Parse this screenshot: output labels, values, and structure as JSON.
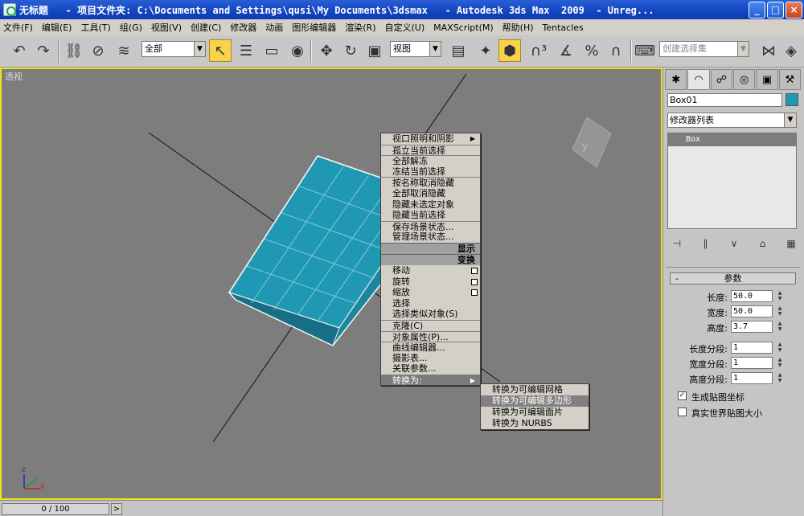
{
  "window": {
    "title": "无标题   - 项目文件夹: C:\\Documents and Settings\\qusi\\My Documents\\3dsmax   - Autodesk 3ds Max  2009  - Unreg...",
    "min": "_",
    "max": "□",
    "close": "×"
  },
  "menu": [
    "文件(F)",
    "编辑(E)",
    "工具(T)",
    "组(G)",
    "视图(V)",
    "创建(C)",
    "修改器",
    "动画",
    "图形编辑器",
    "渲染(R)",
    "自定义(U)",
    "MAXScript(M)",
    "帮助(H)",
    "Tentacles"
  ],
  "toolbar": {
    "selection_filter": "全部",
    "ref_coord": "视图",
    "named_selection": "创建选择集"
  },
  "viewport": {
    "label": "透视",
    "axis_x": "x",
    "axis_y": "y",
    "axis_z": "z",
    "border_color": "#f2e21a",
    "box_color": "#1f98b3"
  },
  "context_menu": {
    "display_items": [
      "视口照明和阴影",
      "孤立当前选择",
      "全部解冻",
      "冻结当前选择",
      "按名称取消隐藏",
      "全部取消隐藏",
      "隐藏未选定对象",
      "隐藏当前选择",
      "保存场景状态...",
      "管理场景状态..."
    ],
    "display_header": "显示",
    "transform_header": "变换",
    "transform_items": [
      "移动",
      "旋转",
      "缩放",
      "选择",
      "选择类似对象(S)",
      "克隆(C)",
      "对象属性(P)...",
      "曲线编辑器...",
      "摄影表...",
      "关联参数...",
      "转换为:"
    ],
    "convert_submenu": [
      "转换为可编辑网格",
      "转换为可编辑多边形",
      "转换为可编辑面片",
      "转换为 NURBS"
    ]
  },
  "command_panel": {
    "object_name": "Box01",
    "object_color": "#1f98b3",
    "modifier_list": "修改器列表",
    "stack_item": "Box",
    "rollout_title": "参数",
    "rollout_toggle": "-",
    "params": [
      {
        "label": "长度:",
        "value": "50.0"
      },
      {
        "label": "宽度:",
        "value": "50.0"
      },
      {
        "label": "高度:",
        "value": "3.7"
      },
      {
        "label": "长度分段:",
        "value": "1"
      },
      {
        "label": "宽度分段:",
        "value": "1"
      },
      {
        "label": "高度分段:",
        "value": "1"
      }
    ],
    "gen_mapping": {
      "label": "生成贴图坐标",
      "checked": true
    },
    "real_world": {
      "label": "真实世界贴图大小",
      "checked": false
    }
  },
  "timeline": {
    "frame": "0 / 100",
    "next": ">"
  }
}
